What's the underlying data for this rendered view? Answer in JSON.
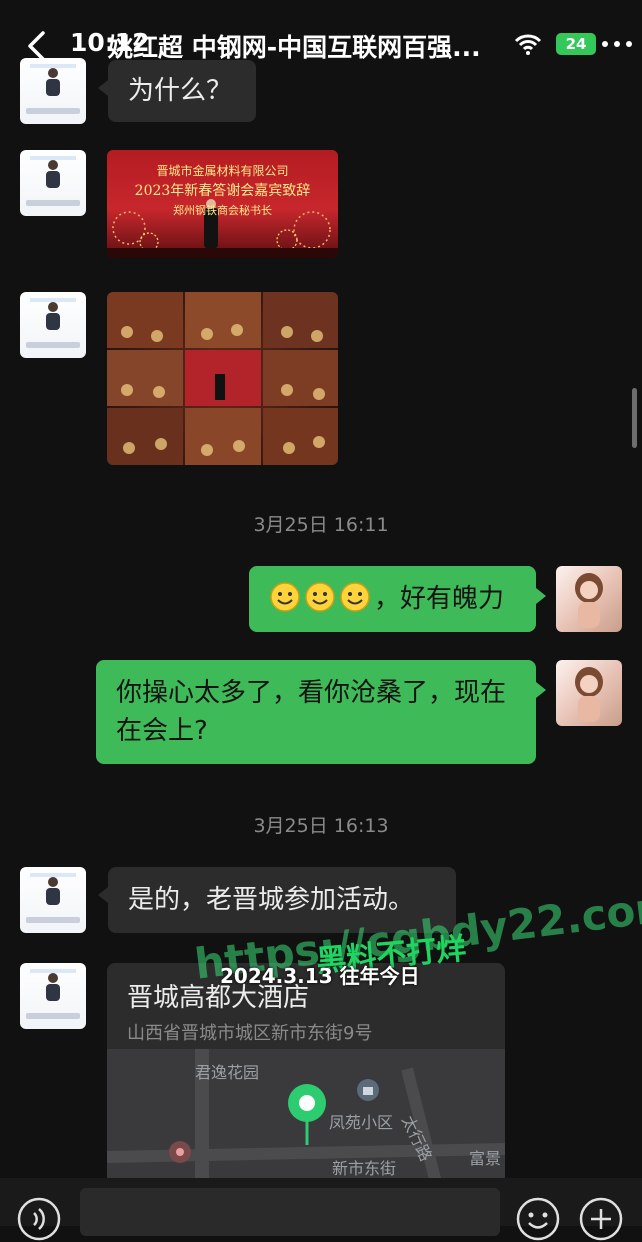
{
  "status_bar": {
    "time": "10:12",
    "battery": "24"
  },
  "header": {
    "title": "姚红超 中钢网-中国互联网百强..."
  },
  "messages": {
    "m1": {
      "text": "为什么？"
    },
    "img1": {
      "line1": "晋城市金属材料有限公司",
      "line2": "2023年新春答谢会嘉宾致辞",
      "line3": "郑州钢铁商会秘书长"
    },
    "ts1": "3月25日 16:11",
    "m2": {
      "text": "，好有魄力"
    },
    "m3": {
      "text": "你操心太多了，看你沧桑了，现在在会上?"
    },
    "ts2": "3月25日 16:13",
    "m4": {
      "text": "是的，老晋城参加活动。"
    },
    "location": {
      "title": "晋城高都大酒店",
      "address": "山西省晋城市城区新市东街9号",
      "map_labels": {
        "garden": "君逸花园",
        "community": "凤苑小区",
        "road1": "太行路",
        "road2": "新市东街",
        "other": "富景"
      }
    }
  },
  "watermark": {
    "date": "2024.3.13 往年今日",
    "site_cn": "黑料不打烊",
    "url": "https://cgbdy22.com"
  },
  "colors": {
    "green_bubble": "#3fba59",
    "dark_bubble": "#2c2c2c",
    "background": "#111111"
  },
  "icons": [
    "back-icon",
    "wifi-icon",
    "more-icon",
    "voice-icon",
    "emoji-icon",
    "plus-icon",
    "location-pin-icon"
  ]
}
